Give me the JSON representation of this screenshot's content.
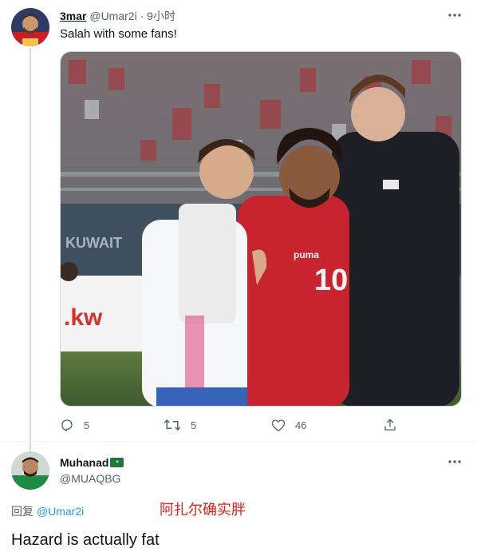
{
  "tweet1": {
    "author": {
      "display_name": "3mar",
      "handle": "@Umar2i",
      "avatar_icon": "avatar-icon"
    },
    "time_sep": " · ",
    "time": "9小时",
    "text": "Salah with some fans!",
    "media": {
      "type": "photo",
      "icon": "photo-icon"
    },
    "stats": {
      "replies": "5",
      "retweets": "5",
      "likes": "46"
    }
  },
  "tweet2": {
    "author": {
      "display_name": "Muhanad",
      "handle": "@MUAQBG",
      "badge": "flag-badge"
    },
    "reply_to_label": "回复",
    "reply_to_handle": "@Umar2i",
    "annotation": "阿扎尔确实胖",
    "text": "Hazard is actually fat"
  },
  "colors": {
    "link": "#1d9bf0",
    "muted": "#536471",
    "text": "#0f1419",
    "annotation": "#e0201b",
    "border": "#cfd9de"
  }
}
